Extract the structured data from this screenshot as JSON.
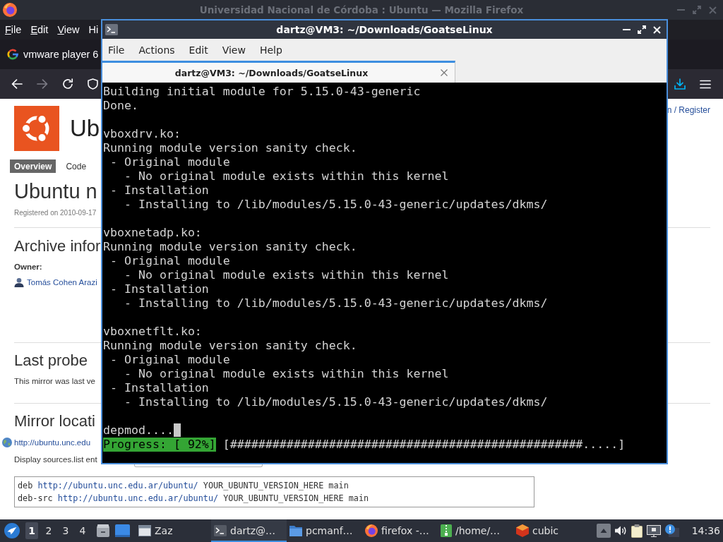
{
  "browser": {
    "title": "Universidad Nacional de Córdoba : Ubuntu — Mozilla Firefox",
    "focused": false,
    "menu": [
      {
        "label": "File",
        "access_key_underlined": true
      },
      {
        "label": "Edit",
        "access_key_underlined": true
      },
      {
        "label": "View",
        "access_key_underlined": true
      },
      {
        "label": "Hi",
        "access_key_underlined": false
      }
    ],
    "tabs": [
      {
        "label": "vmware player 6",
        "selected": false
      }
    ],
    "nav_buttons": [
      {
        "kind": "back",
        "disabled": false
      },
      {
        "kind": "forward",
        "disabled": true
      },
      {
        "kind": "reload",
        "disabled": false
      }
    ],
    "page": {
      "header_title": "Ub",
      "login_link": "n / Register",
      "tabs": [
        {
          "label": "Overview",
          "selected": true
        },
        {
          "label": "Code",
          "selected": false
        }
      ],
      "heading": "Ubuntu n",
      "registered": "Registered on 2010-09-17",
      "archive_section": {
        "heading": "Archive infor",
        "owner_label": "Owner:",
        "owner": "Tomás Cohen Arazi"
      },
      "probe_section": {
        "heading": "Last probe",
        "text": "This mirror was last ve"
      },
      "mirror_section": {
        "heading": "Mirror locati",
        "url": "http://ubuntu.unc.edu",
        "sources_label": "Display sources.list ent",
        "sources_lines": [
          {
            "prefix": "deb",
            "url": "http://ubuntu.unc.edu.ar/ubuntu/",
            "suffix": "YOUR_UBUNTU_VERSION_HERE main"
          },
          {
            "prefix": "deb-src",
            "url": "http://ubuntu.unc.edu.ar/ubuntu/",
            "suffix": "YOUR_UBUNTU_VERSION_HERE main"
          }
        ]
      }
    }
  },
  "terminal": {
    "title": "dartz@VM3: ~/Downloads/GoatseLinux",
    "menu": [
      "File",
      "Actions",
      "Edit",
      "View",
      "Help"
    ],
    "tabs": [
      {
        "label": "dartz@VM3: ~/Downloads/GoatseLinux",
        "selected": true
      }
    ],
    "output": [
      {
        "lines": [
          "Building initial module for 5.15.0-43-generic",
          "Done."
        ]
      },
      {
        "lines": [
          "vboxdrv.ko:",
          "Running module version sanity check.",
          " - Original module",
          "   - No original module exists within this kernel",
          " - Installation",
          "   - Installing to /lib/modules/5.15.0-43-generic/updates/dkms/"
        ]
      },
      {
        "lines": [
          "vboxnetadp.ko:",
          "Running module version sanity check.",
          " - Original module",
          "   - No original module exists within this kernel",
          " - Installation",
          "   - Installing to /lib/modules/5.15.0-43-generic/updates/dkms/"
        ]
      },
      {
        "lines": [
          "vboxnetflt.ko:",
          "Running module version sanity check.",
          " - Original module",
          "   - No original module exists within this kernel",
          " - Installation",
          "   - Installing to /lib/modules/5.15.0-43-generic/updates/dkms/"
        ]
      }
    ],
    "current_line": {
      "text": "depmod....",
      "cursor": true
    },
    "progress": {
      "label": "Progress: [ 92%]",
      "bar": "[##################################################.....]"
    }
  },
  "taskbar": {
    "workspaces": [
      {
        "label": "1",
        "selected": true
      },
      {
        "label": "2",
        "selected": false
      },
      {
        "label": "3",
        "selected": false
      },
      {
        "label": "4",
        "selected": false
      }
    ],
    "tasks": [
      {
        "kind": "window",
        "label": "Zaz",
        "selected": false
      },
      {
        "kind": "terminal",
        "label": "dartz@…",
        "selected": true
      },
      {
        "kind": "folder",
        "label": "pcmanf…",
        "selected": false
      },
      {
        "kind": "browser",
        "label": "firefox -…",
        "selected": false
      },
      {
        "kind": "archive",
        "label": "/home/…",
        "selected": false
      },
      {
        "kind": "cube",
        "label": "cubic",
        "selected": false
      }
    ],
    "clock": "14:36"
  }
}
